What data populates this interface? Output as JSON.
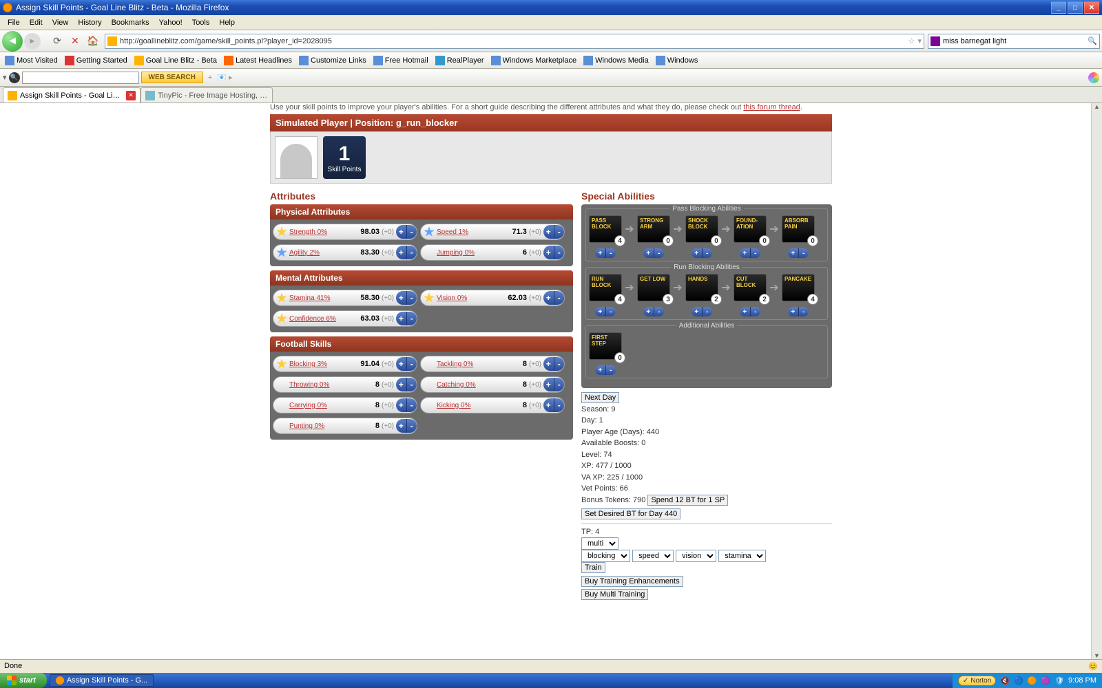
{
  "window": {
    "title": "Assign Skill Points - Goal Line Blitz - Beta - Mozilla Firefox"
  },
  "menu": [
    "File",
    "Edit",
    "View",
    "History",
    "Bookmarks",
    "Yahoo!",
    "Tools",
    "Help"
  ],
  "url": "http://goallineblitz.com/game/skill_points.pl?player_id=2028095",
  "searchbox": {
    "value": "miss barnegat light"
  },
  "websearch_label": "WEB SEARCH",
  "bookmarks": [
    "Most Visited",
    "Getting Started",
    "Goal Line Blitz - Beta",
    "Latest Headlines",
    "Customize Links",
    "Free Hotmail",
    "RealPlayer",
    "Windows Marketplace",
    "Windows Media",
    "Windows"
  ],
  "tabs": [
    {
      "label": "Assign Skill Points - Goal Line Blit..."
    },
    {
      "label": "TinyPic - Free Image Hosting, Photo Sh..."
    }
  ],
  "intro": "Use your skill points to improve your player's abilities. For a short guide describing the different attributes and what they do, please check out ",
  "intro_link": "this forum thread",
  "player_header": "Simulated Player | Position: g_run_blocker",
  "sp": {
    "num": "1",
    "label": "Skill Points"
  },
  "attributes_title": "Attributes",
  "abilities_title": "Special Abilities",
  "groups": [
    {
      "name": "Physical Attributes",
      "rows": [
        {
          "star": "gold",
          "name": "Strength 0%",
          "val": "98.03",
          "delta": "(+0)"
        },
        {
          "star": "blue",
          "name": "Speed 1%",
          "val": "71.3",
          "delta": "(+0)"
        },
        {
          "star": "blue",
          "name": "Agility 2%",
          "val": "83.30",
          "delta": "(+0)"
        },
        {
          "star": "",
          "name": "Jumping 0%",
          "val": "6",
          "delta": "(+0)"
        }
      ]
    },
    {
      "name": "Mental Attributes",
      "rows": [
        {
          "star": "gold",
          "name": "Stamina 41%",
          "val": "58.30",
          "delta": "(+0)"
        },
        {
          "star": "gold",
          "name": "Vision 0%",
          "val": "62.03",
          "delta": "(+0)"
        },
        {
          "star": "gold",
          "name": "Confidence 6%",
          "val": "63.03",
          "delta": "(+0)"
        }
      ]
    },
    {
      "name": "Football Skills",
      "rows": [
        {
          "star": "gold",
          "name": "Blocking 3%",
          "val": "91.04",
          "delta": "(+0)"
        },
        {
          "star": "",
          "name": "Tackling 0%",
          "val": "8",
          "delta": "(+0)"
        },
        {
          "star": "",
          "name": "Throwing 0%",
          "val": "8",
          "delta": "(+0)"
        },
        {
          "star": "",
          "name": "Catching 0%",
          "val": "8",
          "delta": "(+0)"
        },
        {
          "star": "",
          "name": "Carrying 0%",
          "val": "8",
          "delta": "(+0)"
        },
        {
          "star": "",
          "name": "Kicking 0%",
          "val": "8",
          "delta": "(+0)"
        },
        {
          "star": "",
          "name": "Punting 0%",
          "val": "8",
          "delta": "(+0)"
        }
      ]
    }
  ],
  "ability_groups": [
    {
      "legend": "Pass Blocking Abilities",
      "items": [
        {
          "label": "PASS BLOCK",
          "n": "4"
        },
        {
          "label": "STRONG ARM",
          "n": "0"
        },
        {
          "label": "SHOCK BLOCK",
          "n": "0"
        },
        {
          "label": "FOUND-ATION",
          "n": "0"
        },
        {
          "label": "ABSORB PAIN",
          "n": "0"
        }
      ]
    },
    {
      "legend": "Run Blocking Abilities",
      "items": [
        {
          "label": "RUN BLOCK",
          "n": "4"
        },
        {
          "label": "GET LOW",
          "n": "3"
        },
        {
          "label": "HANDS",
          "n": "2"
        },
        {
          "label": "CUT BLOCK",
          "n": "2"
        },
        {
          "label": "PANCAKE",
          "n": "4"
        }
      ]
    },
    {
      "legend": "Additional Abilities",
      "items": [
        {
          "label": "FIRST STEP",
          "n": "0"
        }
      ]
    }
  ],
  "info": {
    "next_day": "Next Day",
    "season": "Season: 9",
    "day": "Day: 1",
    "age": "Player Age (Days): 440",
    "boosts": "Available Boosts: 0",
    "level": "Level: 74",
    "xp": "XP: 477 / 1000",
    "vaxp": "VA XP: 225 / 1000",
    "vet": "Vet Points: 66",
    "bonus_label": "Bonus Tokens: 790",
    "spend_btn": "Spend 12 BT for 1 SP",
    "set_bt_btn": "Set Desired BT for Day 440",
    "tp": "TP: 4",
    "sel1": "multi",
    "sel2": "blocking",
    "sel3": "speed",
    "sel4": "vision",
    "sel5": "stamina",
    "train": "Train",
    "buy_enh": "Buy Training Enhancements",
    "buy_multi": "Buy Multi Training"
  },
  "status": "Done",
  "taskbar": {
    "start": "start",
    "app": "Assign Skill Points - G...",
    "norton": "Norton",
    "time": "9:08 PM"
  }
}
